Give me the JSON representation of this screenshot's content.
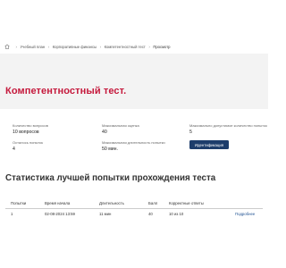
{
  "breadcrumb": {
    "items": [
      "Учебный план",
      "Корпоративные финансы",
      "Компетентностный тест",
      "Просмотр"
    ]
  },
  "page_title": "Компетентностный тест.",
  "info": {
    "questions_label": "Количество вопросов",
    "questions_value": "10 вопросов",
    "max_score_label": "Максимальная оценка",
    "max_score_value": "40",
    "max_attempts_label": "Максимально допустимое количество попыток",
    "max_attempts_value": "5",
    "remaining_label": "Осталось попыток",
    "remaining_value": "4",
    "max_duration_label": "Максимальная длительность попытки",
    "max_duration_value": "50 мин.",
    "identify_button": "Идентификация"
  },
  "stats": {
    "title": "Статистика лучшей попытки прохождения теста",
    "columns": [
      "Попытки",
      "Время начала",
      "Длительность",
      "Балл",
      "Корректные ответы"
    ],
    "rows": [
      {
        "attempt": "1",
        "start": "02-08-2024 13:59",
        "duration": "11 мин",
        "score": "40",
        "correct": "10 из 10",
        "link": "Подробнее"
      }
    ]
  },
  "colors": {
    "accent": "#c5193c",
    "button": "#1d3d6b",
    "hero_bg": "#f3f3f3"
  }
}
